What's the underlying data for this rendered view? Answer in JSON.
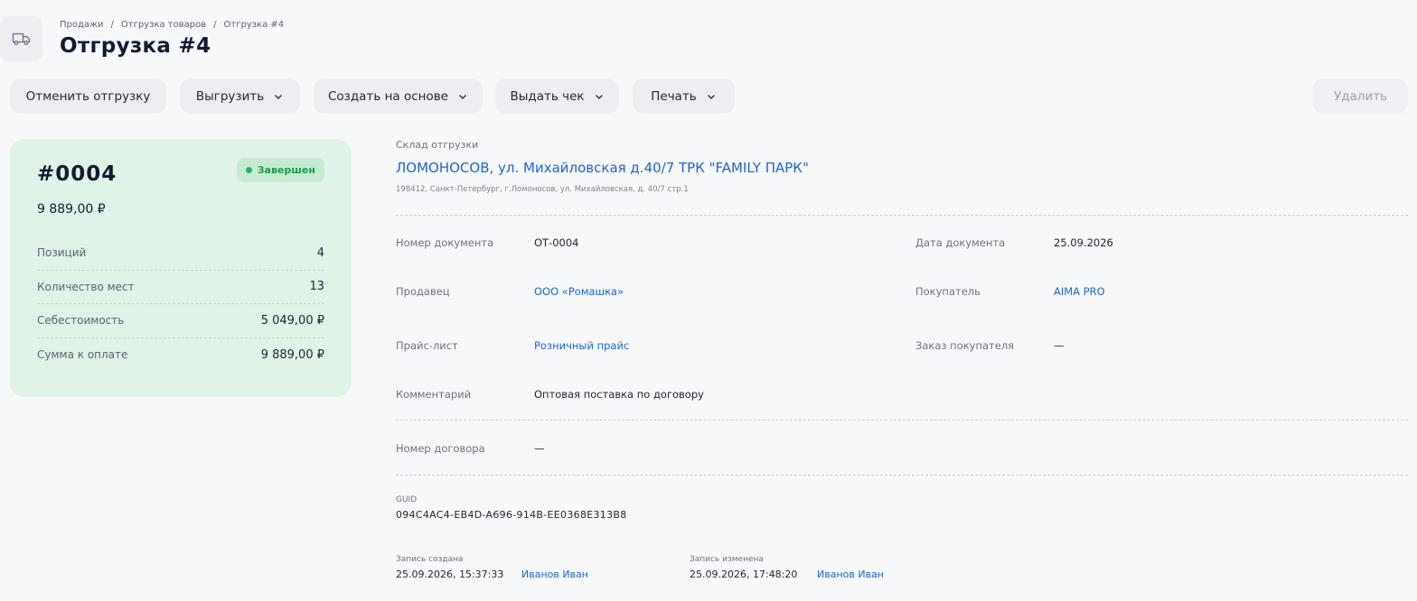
{
  "breadcrumb": [
    "Продажи",
    "Отгрузка товаров",
    "Отгрузка #4"
  ],
  "page_title": "Отгрузка #4",
  "toolbar": {
    "cancel_label": "Отменить отгрузку",
    "export_label": "Выгрузить",
    "create_based_label": "Создать на основе",
    "receipt_label": "Выдать чек",
    "print_label": "Печать",
    "delete_label": "Удалить"
  },
  "summary": {
    "number": "#0004",
    "status": "Завершен",
    "amount": "9 889,00 ₽",
    "rows": [
      {
        "label": "Позиций",
        "value": "4"
      },
      {
        "label": "Количество мест",
        "value": "13"
      },
      {
        "label": "Себестоимость",
        "value": "5 049,00 ₽"
      },
      {
        "label": "Сумма к оплате",
        "value": "9 889,00 ₽"
      }
    ]
  },
  "warehouse": {
    "label": "Склад отгрузки",
    "name": "ЛОМОНОСОВ, ул. Михайловская д.40/7 ТРК \"FAMILY ПАРК\"",
    "address": "198412, Санкт-Петербург, г.Ломоносов, ул. Михайловская, д. 40/7 стр.1"
  },
  "fields": {
    "doc_number": {
      "label": "Номер документа",
      "value": "ОТ-0004"
    },
    "doc_date": {
      "label": "Дата документа",
      "value": "25.09.2026"
    },
    "seller": {
      "label": "Продавец",
      "value": "ООО «Ромашка»"
    },
    "buyer": {
      "label": "Покупатель",
      "value": "AIMA PRO"
    },
    "price_list": {
      "label": "Прайс-лист",
      "value": "Розничный прайс"
    },
    "customer_order": {
      "label": "Заказ покупателя",
      "value": "—"
    },
    "comment": {
      "label": "Комментарий",
      "value": "Оптовая поставка по договору"
    },
    "contract_number": {
      "label": "Номер договора",
      "value": "—"
    }
  },
  "guid": {
    "label": "GUID",
    "value": "094C4AC4-EB4D-A696-914B-EE0368E313B8"
  },
  "record_created": {
    "label": "Запись создана",
    "datetime": "25.09.2026, 15:37:33",
    "user": "Иванов Иван"
  },
  "record_modified": {
    "label": "Запись изменена",
    "datetime": "25.09.2026, 17:48:20",
    "user": "Иванов Иван"
  },
  "icons": {
    "header": "truck-icon",
    "dropdown": "chevron-down-icon"
  },
  "colors": {
    "accent": "#1e63d6",
    "status": "#1a9b45",
    "card": "#dff3e6"
  }
}
